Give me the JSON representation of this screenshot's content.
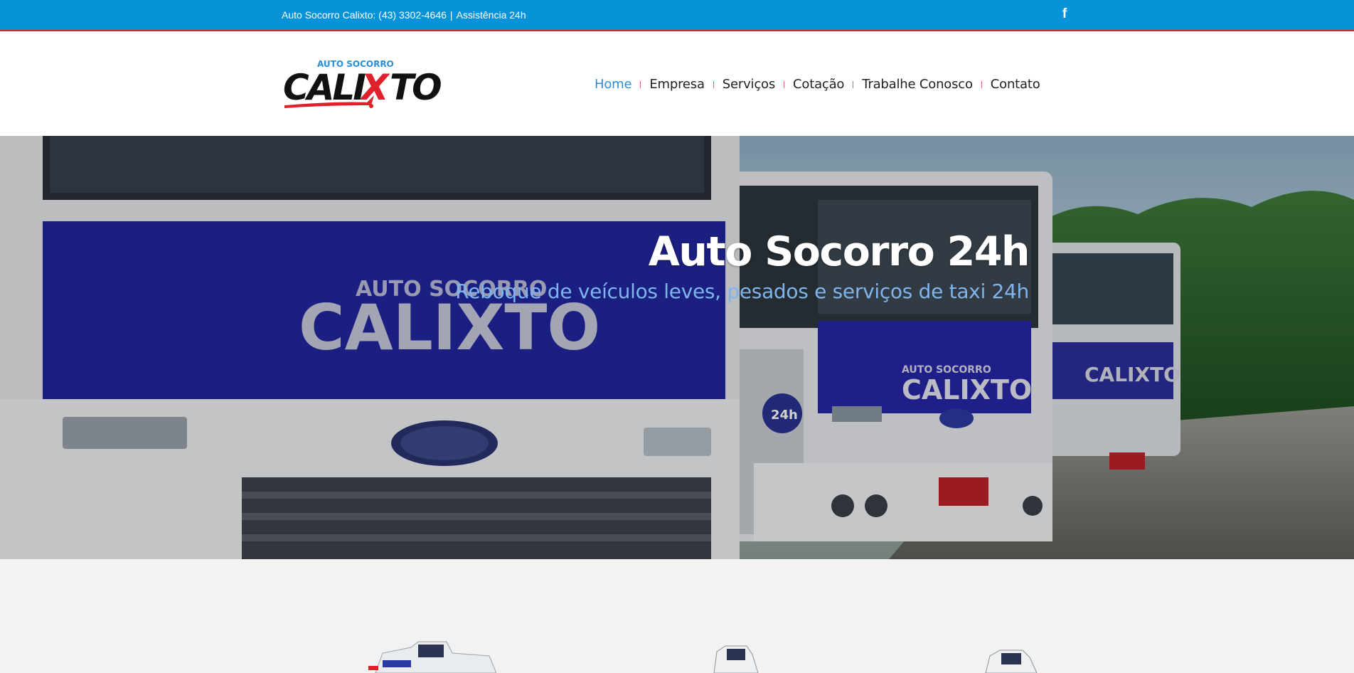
{
  "topbar": {
    "contact_text": "Auto Socorro Calixto: (43) 3302-4646",
    "separator": "|",
    "assist_text": "Assistência 24h",
    "facebook_icon": "facebook-icon",
    "facebook_glyph": "f"
  },
  "logo": {
    "small_text": "AUTO SOCORRO",
    "name_left": "CALI",
    "name_mid": "X",
    "name_right": "TO",
    "colors": {
      "blue": "#2a8fd6",
      "red": "#e0202a",
      "black": "#111111"
    }
  },
  "nav": {
    "items": [
      {
        "label": "Home",
        "active": true
      },
      {
        "label": "Empresa",
        "active": false
      },
      {
        "label": "Serviços",
        "active": false
      },
      {
        "label": "Cotação",
        "active": false
      },
      {
        "label": "Trabalhe Conosco",
        "active": false
      },
      {
        "label": "Contato",
        "active": false
      }
    ]
  },
  "hero": {
    "title": "Auto Socorro 24h",
    "subtitle": "Reboque de veículos leves, pesados e serviços de taxi 24h",
    "image_description_icon": "tow-truck-fleet-photo",
    "truck_logo_text_small": "AUTO SOCORRO",
    "truck_logo_text": "CALIXTO",
    "badge_text": "24h"
  },
  "colors": {
    "topbar_bg": "#0893d9",
    "topbar_border": "#d8232a",
    "nav_active": "#2a8fd6",
    "subtitle": "#7fb4ec"
  }
}
